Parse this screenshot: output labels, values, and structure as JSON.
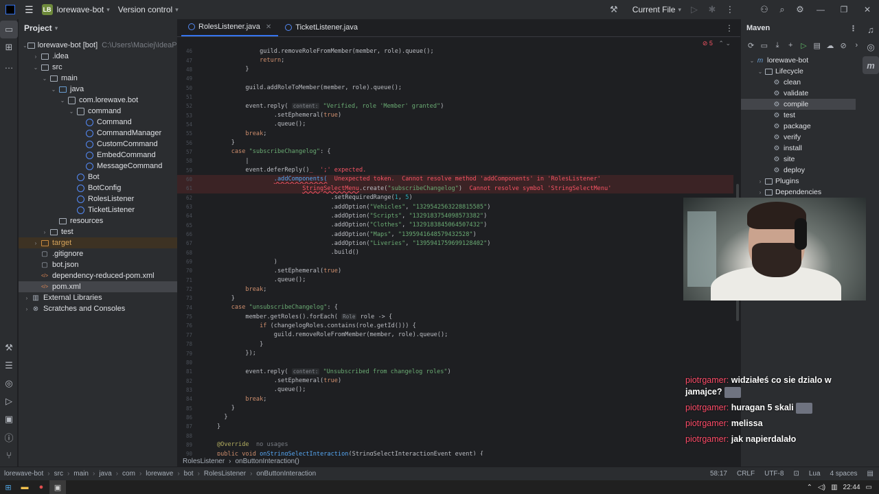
{
  "titlebar": {
    "project_badge": "LB",
    "project_name": "lorewave-bot",
    "vcs": "Version control",
    "run_config": "Current File"
  },
  "project_panel": {
    "title": "Project",
    "rows": [
      {
        "indent": 0,
        "arrow": "▾",
        "icon": "folder",
        "label": "lorewave-bot [bot]",
        "extra": "C:\\Users\\Maciej\\IdeaPro",
        "bold": true
      },
      {
        "indent": 1,
        "arrow": "›",
        "icon": "folder",
        "label": ".idea"
      },
      {
        "indent": 1,
        "arrow": "▾",
        "icon": "folder",
        "label": "src"
      },
      {
        "indent": 2,
        "arrow": "▾",
        "icon": "folder",
        "label": "main"
      },
      {
        "indent": 3,
        "arrow": "▾",
        "icon": "folder-src",
        "label": "java"
      },
      {
        "indent": 4,
        "arrow": "▾",
        "icon": "package",
        "label": "com.lorewave.bot"
      },
      {
        "indent": 5,
        "arrow": "▾",
        "icon": "package",
        "label": "command"
      },
      {
        "indent": 6,
        "arrow": "",
        "icon": "class",
        "label": "Command"
      },
      {
        "indent": 6,
        "arrow": "",
        "icon": "class",
        "label": "CommandManager"
      },
      {
        "indent": 6,
        "arrow": "",
        "icon": "class",
        "label": "CustomCommand"
      },
      {
        "indent": 6,
        "arrow": "",
        "icon": "class",
        "label": "EmbedCommand"
      },
      {
        "indent": 6,
        "arrow": "",
        "icon": "class",
        "label": "MessageCommand"
      },
      {
        "indent": 5,
        "arrow": "",
        "icon": "class",
        "label": "Bot"
      },
      {
        "indent": 5,
        "arrow": "",
        "icon": "class",
        "label": "BotConfig"
      },
      {
        "indent": 5,
        "arrow": "",
        "icon": "class",
        "label": "RolesListener"
      },
      {
        "indent": 5,
        "arrow": "",
        "icon": "class",
        "label": "TicketListener"
      },
      {
        "indent": 3,
        "arrow": "",
        "icon": "folder",
        "label": "resources"
      },
      {
        "indent": 2,
        "arrow": "›",
        "icon": "folder",
        "label": "test"
      },
      {
        "indent": 1,
        "arrow": "›",
        "icon": "folder-orange",
        "label": "target",
        "highlight": true
      },
      {
        "indent": 1,
        "arrow": "",
        "icon": "file",
        "label": ".gitignore"
      },
      {
        "indent": 1,
        "arrow": "",
        "icon": "file",
        "label": "bot.json"
      },
      {
        "indent": 1,
        "arrow": "",
        "icon": "xml",
        "label": "dependency-reduced-pom.xml"
      },
      {
        "indent": 1,
        "arrow": "",
        "icon": "xml",
        "label": "pom.xml",
        "selected": true
      },
      {
        "indent": 0,
        "arrow": "›",
        "icon": "library",
        "label": "External Libraries"
      },
      {
        "indent": 0,
        "arrow": "›",
        "icon": "scratch",
        "label": "Scratches and Consoles"
      }
    ]
  },
  "editor": {
    "tabs": [
      {
        "label": "RolesListener.java",
        "active": true
      },
      {
        "label": "TicketListener.java",
        "active": false
      }
    ],
    "problems": "5",
    "breadcrumb": [
      "RolesListener",
      "onButtonInteraction()"
    ]
  },
  "code_lines": [
    {
      "n": "46",
      "html": "            <span class='cl'>guild.removeRoleFromMember(member, role).queue();</span>"
    },
    {
      "n": "47",
      "html": "            <span class='kw'>return</span><span class='cl'>;</span>"
    },
    {
      "n": "48",
      "html": "        <span class='cl'>}</span>"
    },
    {
      "n": "49",
      "html": ""
    },
    {
      "n": "50",
      "html": "        <span class='cl'>guild.addRoleToMember(member, role).queue();</span>"
    },
    {
      "n": "51",
      "html": ""
    },
    {
      "n": "52",
      "html": "        <span class='cl'>event.reply(</span> <span class='hint'>content:</span> <span class='st'>\"Verified, role 'Member' granted\"</span><span class='cl'>)</span>"
    },
    {
      "n": "53",
      "html": "                <span class='cl'>.setEphemeral(</span><span class='kw'>true</span><span class='cl'>)</span>"
    },
    {
      "n": "54",
      "html": "                <span class='cl'>.queue();</span>"
    },
    {
      "n": "55",
      "html": "        <span class='kw'>break</span><span class='cl'>;</span>"
    },
    {
      "n": "56",
      "html": "    <span class='cl'>}</span>"
    },
    {
      "n": "57",
      "html": "    <span class='kw'>case</span> <span class='st'>\"subscribeChangelog\"</span><span class='cl'>: {</span>"
    },
    {
      "n": "58",
      "html": "        <span class='cl'>|</span>"
    },
    {
      "n": "59",
      "html": "        <span class='cl'>event.deferReply()</span><span class='err'>_</span>  <span class='err'>';' expected.</span>"
    },
    {
      "n": "60",
      "err": true,
      "html": "                <span class='fn warn'>.addComponents(</span>  <span class='err'>Unexpected token.  Cannot resolve method 'addComponents' in 'RolesListener'</span>"
    },
    {
      "n": "61",
      "err": true,
      "html": "                        <span class='err warn'>StringSelectMenu</span><span class='cl'>.create(</span><span class='st'>\"subscribeChangelog\"</span><span class='cl'>)</span>  <span class='err'>Cannot resolve symbol 'StringSelectMenu'</span>"
    },
    {
      "n": "62",
      "html": "                                <span class='cl'>.setRequiredRange(</span><span class='nm'>1</span><span class='cl'>, </span><span class='nm'>5</span><span class='cl'>)</span>"
    },
    {
      "n": "63",
      "html": "                                <span class='cl'>.addOption(</span><span class='st'>\"Vehicles\"</span><span class='cl'>, </span><span class='st'>\"1329542563228815585\"</span><span class='cl'>)</span>"
    },
    {
      "n": "64",
      "html": "                                <span class='cl'>.addOption(</span><span class='st'>\"Scripts\"</span><span class='cl'>, </span><span class='st'>\"1329183754098573382\"</span><span class='cl'>)</span>"
    },
    {
      "n": "65",
      "html": "                                <span class='cl'>.addOption(</span><span class='st'>\"Clothes\"</span><span class='cl'>, </span><span class='st'>\"1329183845064507432\"</span><span class='cl'>)</span>"
    },
    {
      "n": "66",
      "html": "                                <span class='cl'>.addOption(</span><span class='st'>\"Maps\"</span><span class='cl'>, </span><span class='st'>\"1395941648579432528\"</span><span class='cl'>)</span>"
    },
    {
      "n": "67",
      "html": "                                <span class='cl'>.addOption(</span><span class='st'>\"Liveries\"</span><span class='cl'>, </span><span class='st'>\"1395941759699128402\"</span><span class='cl'>)</span>"
    },
    {
      "n": "68",
      "html": "                                <span class='cl'>.build()</span>"
    },
    {
      "n": "69",
      "html": "                <span class='cl'>)</span>"
    },
    {
      "n": "70",
      "html": "                <span class='cl'>.setEphemeral(</span><span class='kw'>true</span><span class='cl'>)</span>"
    },
    {
      "n": "71",
      "html": "                <span class='cl'>.queue();</span>"
    },
    {
      "n": "72",
      "html": "        <span class='kw'>break</span><span class='cl'>;</span>"
    },
    {
      "n": "73",
      "html": "    <span class='cl'>}</span>"
    },
    {
      "n": "74",
      "html": "    <span class='kw'>case</span> <span class='st'>\"unsubscribeChangelog\"</span><span class='cl'>: {</span>"
    },
    {
      "n": "75",
      "html": "        <span class='cl'>member.getRoles().forEach(</span> <span class='hint'>Role</span> <span class='cl'>role -&gt; {</span>"
    },
    {
      "n": "76",
      "html": "            <span class='kw'>if</span> <span class='cl'>(changelogRoles.contains(role.getId())) {</span>"
    },
    {
      "n": "77",
      "html": "                <span class='cl'>guild.removeRoleFromMember(member, role).queue();</span>"
    },
    {
      "n": "78",
      "html": "            <span class='cl'>}</span>"
    },
    {
      "n": "79",
      "html": "        <span class='cl'>});</span>"
    },
    {
      "n": "80",
      "html": ""
    },
    {
      "n": "81",
      "html": "        <span class='cl'>event.reply(</span> <span class='hint'>content:</span> <span class='st'>\"Unsubscribed from changelog roles\"</span><span class='cl'>)</span>"
    },
    {
      "n": "82",
      "html": "                <span class='cl'>.setEphemeral(</span><span class='kw'>true</span><span class='cl'>)</span>"
    },
    {
      "n": "83",
      "html": "                <span class='cl'>.queue();</span>"
    },
    {
      "n": "84",
      "html": "        <span class='kw'>break</span><span class='cl'>;</span>"
    },
    {
      "n": "85",
      "html": "    <span class='cl'>}</span>"
    },
    {
      "n": "86",
      "html": "  <span class='cl'>}</span>"
    },
    {
      "n": "87",
      "html": "<span class='cl'>}</span>"
    },
    {
      "n": "88",
      "html": ""
    },
    {
      "n": "89",
      "html": "<span class='anno'>@Override</span>  <span class='gr'>no usages</span>"
    },
    {
      "n": "90",
      "html": "<span class='kw'>public void</span> <span class='fn'>onStringSelectInteraction</span><span class='cl'>(StringSelectInteractionEvent event) {</span>"
    }
  ],
  "maven": {
    "title": "Maven",
    "rows": [
      {
        "indent": 0,
        "arrow": "▾",
        "icon": "m",
        "label": "lorewave-bot"
      },
      {
        "indent": 1,
        "arrow": "▾",
        "icon": "folder",
        "label": "Lifecycle"
      },
      {
        "indent": 2,
        "arrow": "",
        "icon": "gear",
        "label": "clean"
      },
      {
        "indent": 2,
        "arrow": "",
        "icon": "gear",
        "label": "validate"
      },
      {
        "indent": 2,
        "arrow": "",
        "icon": "gear",
        "label": "compile",
        "selected": true
      },
      {
        "indent": 2,
        "arrow": "",
        "icon": "gear",
        "label": "test"
      },
      {
        "indent": 2,
        "arrow": "",
        "icon": "gear",
        "label": "package"
      },
      {
        "indent": 2,
        "arrow": "",
        "icon": "gear",
        "label": "verify"
      },
      {
        "indent": 2,
        "arrow": "",
        "icon": "gear",
        "label": "install"
      },
      {
        "indent": 2,
        "arrow": "",
        "icon": "gear",
        "label": "site"
      },
      {
        "indent": 2,
        "arrow": "",
        "icon": "gear",
        "label": "deploy"
      },
      {
        "indent": 1,
        "arrow": "›",
        "icon": "folder",
        "label": "Plugins"
      },
      {
        "indent": 1,
        "arrow": "›",
        "icon": "folder",
        "label": "Dependencies"
      }
    ]
  },
  "chat": [
    {
      "user": "piotrgamer:",
      "text": "widziałeś co sie dzialo w jamajce?",
      "emote": true
    },
    {
      "user": "piotrgamer:",
      "text": "huragan 5 skali",
      "emote": true
    },
    {
      "user": "piotrgamer:",
      "text": "melissa",
      "emote": false
    },
    {
      "user": "piotrgamer:",
      "text": "jak napierdalało",
      "emote": false
    }
  ],
  "statusbar": {
    "path": [
      "lorewave-bot",
      "src",
      "main",
      "java",
      "com",
      "lorewave",
      "bot",
      "RolesListener",
      "onButtonInteraction"
    ],
    "position": "58:17",
    "line_sep": "CRLF",
    "encoding": "UTF-8",
    "lang": "Lua",
    "indent": "4 spaces"
  },
  "taskbar": {
    "time": "22:44"
  }
}
